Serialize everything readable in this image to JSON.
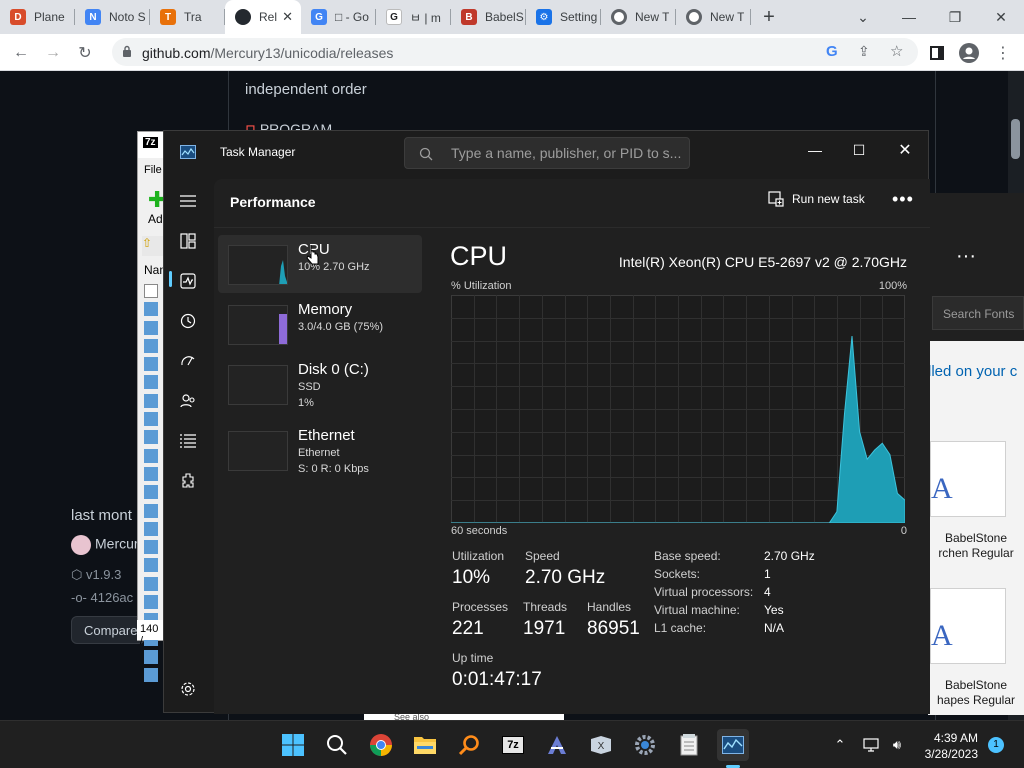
{
  "browser": {
    "tabs": [
      {
        "title": "Plane",
        "fav_color": "#d84c2b",
        "fav_glyph": "D",
        "icon": "planet-icon"
      },
      {
        "title": "Noto S",
        "fav_color": "#4285f4",
        "fav_glyph": "N",
        "icon": "noto-icon"
      },
      {
        "title": "Tra",
        "fav_color": "#e8710a",
        "fav_glyph": "T",
        "icon": "translate-icon"
      },
      {
        "title": "Rel",
        "fav_color": "#24292f",
        "fav_glyph": "",
        "icon": "github-icon",
        "active": true
      },
      {
        "title": "□ - Go",
        "fav_color": "#4285f4",
        "fav_glyph": "G",
        "icon": "google-icon"
      },
      {
        "title": "ㅂ | m",
        "fav_color": "#ffffff",
        "fav_glyph": "G",
        "icon": "google-icon"
      },
      {
        "title": "BabelS",
        "fav_color": "#c0392b",
        "fav_glyph": "B",
        "icon": "babelstone-icon"
      },
      {
        "title": "Setting",
        "fav_color": "#1a73e8",
        "fav_glyph": "⚙",
        "icon": "settings-icon"
      },
      {
        "title": "New T",
        "fav_color": "#5f6368",
        "fav_glyph": "",
        "icon": "chrome-icon"
      },
      {
        "title": "New T",
        "fav_color": "#5f6368",
        "fav_glyph": "",
        "icon": "chrome-icon"
      }
    ],
    "url_host": "github.com",
    "url_path": "/Mercury13/unicodia/releases"
  },
  "github": {
    "body_text": "independent order",
    "program_text": "PROGRAM",
    "last_month": "last mont",
    "author": "Mercur",
    "tag": "v1.9.3",
    "commit": "4126ac",
    "compare_label": "Compare"
  },
  "zip": {
    "title": "7z",
    "menu": "File",
    "add_label": "Ad",
    "column": "Nam",
    "status": "140 /"
  },
  "fonts": {
    "search_placeholder": "Search Fonts",
    "installed_text": "lled on your c",
    "cards": [
      {
        "line1": "BabelStone",
        "line2": "rchen Regular"
      },
      {
        "line1": "BabelStone",
        "line2": "hapes Regular"
      }
    ],
    "see_also": "See also"
  },
  "taskmanager": {
    "title": "Task Manager",
    "search_placeholder": "Type a name, publisher, or PID to s...",
    "section_title": "Performance",
    "run_new_task": "Run new task",
    "resources": [
      {
        "name": "CPU",
        "sub1": "10% 2.70 GHz",
        "sub2": "",
        "selected": true
      },
      {
        "name": "Memory",
        "sub1": "3.0/4.0 GB (75%)",
        "sub2": ""
      },
      {
        "name": "Disk 0 (C:)",
        "sub1": "SSD",
        "sub2": "1%"
      },
      {
        "name": "Ethernet",
        "sub1": "Ethernet",
        "sub2": "S: 0 R: 0 Kbps"
      }
    ],
    "detail": {
      "heading": "CPU",
      "model": "Intel(R) Xeon(R) CPU E5-2697 v2 @ 2.70GHz",
      "util_label": "% Utilization",
      "max_label": "100%",
      "time_label": "60 seconds",
      "min_label": "0",
      "utilization_label": "Utilization",
      "utilization_value": "10%",
      "speed_label": "Speed",
      "speed_value": "2.70 GHz",
      "processes_label": "Processes",
      "processes_value": "221",
      "threads_label": "Threads",
      "threads_value": "1971",
      "handles_label": "Handles",
      "handles_value": "86951",
      "uptime_label": "Up time",
      "uptime_value": "0:01:47:17",
      "specs": [
        {
          "key": "Base speed:",
          "value": "2.70 GHz"
        },
        {
          "key": "Sockets:",
          "value": "1"
        },
        {
          "key": "Virtual processors:",
          "value": "4"
        },
        {
          "key": "Virtual machine:",
          "value": "Yes"
        },
        {
          "key": "L1 cache:",
          "value": "N/A"
        }
      ]
    },
    "cpu_history": [
      0,
      0,
      0,
      0,
      0,
      0,
      0,
      0,
      0,
      0,
      0,
      0,
      0,
      0,
      0,
      0,
      0,
      0,
      0,
      0,
      0,
      0,
      0,
      0,
      0,
      0,
      0,
      0,
      0,
      0,
      0,
      0,
      0,
      0,
      0,
      0,
      0,
      0,
      0,
      0,
      0,
      0,
      0,
      0,
      0,
      0,
      0,
      0,
      0,
      0,
      0,
      5,
      48,
      82,
      40,
      28,
      32,
      35,
      30,
      13,
      10
    ],
    "accent": "#1e9eb5"
  },
  "taskbar": {
    "time": "4:39 AM",
    "date": "3/28/2023",
    "notification_count": "1"
  }
}
